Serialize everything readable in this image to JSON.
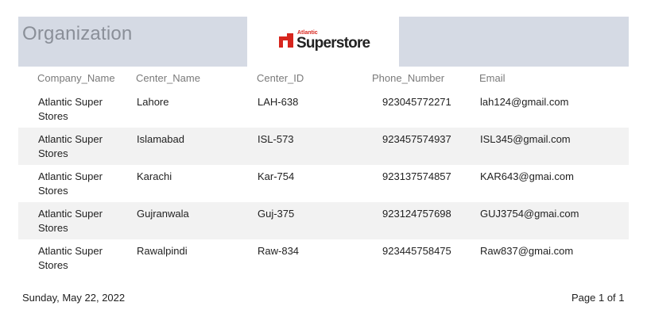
{
  "report": {
    "title": "Organization",
    "logo": {
      "small_text": "Atlantic",
      "big_text": "Superstore"
    },
    "colors": {
      "header_band": "#d5dae4",
      "alt_row": "#f2f2f2",
      "logo_red": "#d7261e"
    }
  },
  "columns": [
    "Company_Name",
    "Center_Name",
    "Center_ID",
    "Phone_Number",
    "Email"
  ],
  "rows": [
    {
      "company": "Atlantic Super Stores",
      "center": "Lahore",
      "id": "LAH-638",
      "phone": "923045772271",
      "email": "lah124@gmail.com"
    },
    {
      "company": "Atlantic Super Stores",
      "center": "Islamabad",
      "id": "ISL-573",
      "phone": "923457574937",
      "email": "ISL345@gmail.com"
    },
    {
      "company": "Atlantic Super Stores",
      "center": "Karachi",
      "id": "Kar-754",
      "phone": "923137574857",
      "email": "KAR643@gmai.com"
    },
    {
      "company": "Atlantic Super Stores",
      "center": "Gujranwala",
      "id": "Guj-375",
      "phone": "923124757698",
      "email": "GUJ3754@gmai.com"
    },
    {
      "company": "Atlantic Super Stores",
      "center": "Rawalpindi",
      "id": "Raw-834",
      "phone": "923445758475",
      "email": "Raw837@gmai.com"
    }
  ],
  "footer": {
    "date": "Sunday, May 22, 2022",
    "page": "Page 1 of 1"
  }
}
